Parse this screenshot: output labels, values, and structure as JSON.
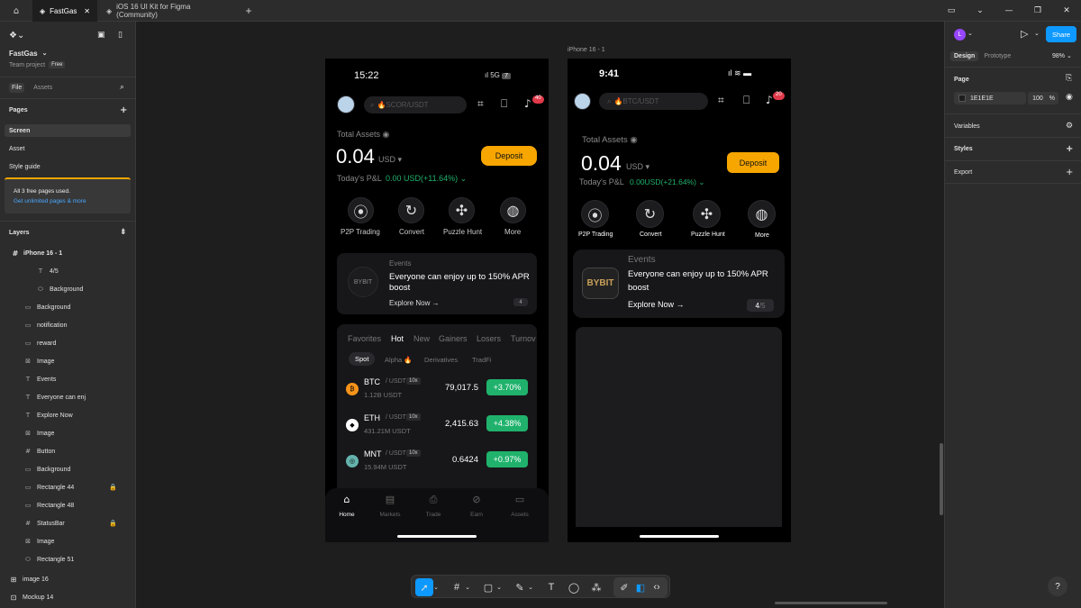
{
  "tabs": {
    "active": "FastGas",
    "second": "iOS 16 UI Kit for Figma (Community)",
    "add": "+"
  },
  "left": {
    "project_name": "FastGas",
    "team": "Team project",
    "plan": "Free",
    "file_tab": "File",
    "assets_tab": "Assets",
    "pages_header": "Pages",
    "pages": [
      "Screen",
      "Asset",
      "Style guide"
    ],
    "banner_title": "All 3 free pages used.",
    "banner_link": "Get unlimited pages & more",
    "layers_header": "Layers",
    "root_layer": "iPhone 16 - 1",
    "layers": [
      "4/5",
      "Background",
      "Background",
      "notification",
      "reward",
      "Image",
      "Events",
      "Everyone can enj",
      "Explore Now",
      "Image",
      "Button",
      "Background",
      "Rectangle 44",
      "Rectangle 48",
      "StatusBar",
      "Image",
      "Rectangle 51"
    ],
    "bottom_layers": [
      "image 16",
      "Mockup 14"
    ]
  },
  "right": {
    "avatar": "L",
    "share": "Share",
    "design_tab": "Design",
    "prototype_tab": "Prototype",
    "zoom": "98%",
    "page_label": "Page",
    "page_color": "1E1E1E",
    "page_opacity": "100",
    "percent": "%",
    "variables": "Variables",
    "styles": "Styles",
    "export": "Export"
  },
  "canvas": {
    "frame_label": "iPhone 16 - 1"
  },
  "phone1": {
    "time": "15:22",
    "network": "5G",
    "battery": "7",
    "search": "SCOR/USDT",
    "notif_count": "40",
    "total_assets": "Total Assets",
    "balance": "0.04",
    "currency": "USD",
    "deposit": "Deposit",
    "pnl_label": "Today's P&L",
    "pnl_value": "0.00 USD(+11.64%)",
    "actions": [
      "P2P Trading",
      "Convert",
      "Puzzle Hunt",
      "More"
    ],
    "events_label": "Events",
    "events_text_1": "Everyone can enjoy up to 150% APR",
    "events_text_2": "boost",
    "explore": "Explore Now →",
    "pager": "4",
    "logo": "BYBIT",
    "market_tabs": [
      "Favorites",
      "Hot",
      "New",
      "Gainers",
      "Losers",
      "Turnov"
    ],
    "sub_tabs": [
      "Spot",
      "Alpha 🔥",
      "Derivatives",
      "TradFi"
    ],
    "rows": [
      {
        "sym": "BTC",
        "pair": "/ USDT",
        "lev": "10x",
        "vol": "1.12B USDT",
        "price": "79,017.5",
        "change": "+3.70%"
      },
      {
        "sym": "ETH",
        "pair": "/ USDT",
        "lev": "10x",
        "vol": "431.21M USDT",
        "price": "2,415.63",
        "change": "+4.38%"
      },
      {
        "sym": "MNT",
        "pair": "/ USDT",
        "lev": "10x",
        "vol": "15.94M USDT",
        "price": "0.6424",
        "change": "+0.97%"
      }
    ],
    "nav": [
      "Home",
      "Markets",
      "Trade",
      "Earn",
      "Assets"
    ]
  },
  "phone2": {
    "time": "9:41",
    "search": "BTC/USDT",
    "notif_count": "20",
    "total_assets": "Total Assets",
    "balance": "0.04",
    "currency": "USD",
    "deposit": "Deposit",
    "pnl_label": "Today's P&L",
    "pnl_value": "0.00USD(+21.64%)",
    "actions": [
      "P2P Trading",
      "Convert",
      "Puzzle Hunt",
      "More"
    ],
    "events_label": "Events",
    "events_text_1": "Everyone can enjoy up to 150% APR",
    "events_text_2": "boost",
    "explore": "Explore Now →",
    "pager_cur": "4",
    "pager_total": "/5",
    "logo": "BYBIT"
  },
  "colors": {
    "accent": "#0d99ff",
    "deposit": "#f7a600",
    "green": "#20b26c",
    "page_bg": "#1e1e1e"
  }
}
